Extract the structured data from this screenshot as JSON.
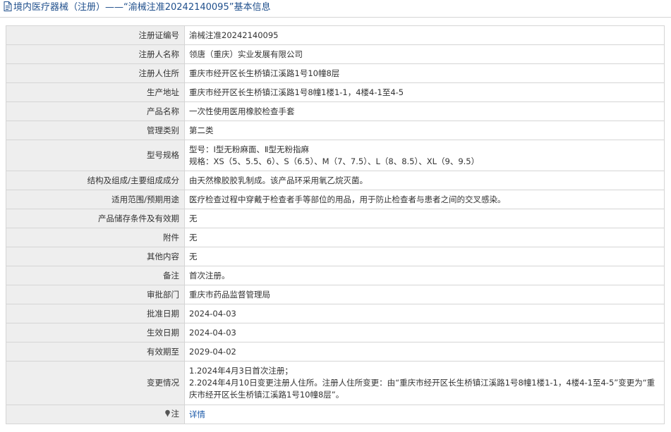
{
  "header": {
    "title": "境内医疗器械（注册）——“渝械注准20242140095”基本信息"
  },
  "fields": {
    "reg_no": {
      "label": "注册证编号",
      "value": "渝械注准20242140095"
    },
    "registrant": {
      "label": "注册人名称",
      "value": "领唐（重庆）实业发展有限公司"
    },
    "registrant_address": {
      "label": "注册人住所",
      "value": "重庆市经开区长生桥镇江溪路1号10幢8层"
    },
    "production_address": {
      "label": "生产地址",
      "value": "重庆市经开区长生桥镇江溪路1号8幢1楼1-1，4楼4-1至4-5"
    },
    "product_name": {
      "label": "产品名称",
      "value": "一次性使用医用橡胶检查手套"
    },
    "category": {
      "label": "管理类别",
      "value": "第二类"
    },
    "model": {
      "label": "型号规格",
      "line1": "型号：Ⅰ型无粉麻面、Ⅱ型无粉指麻",
      "line2": "规格：XS（5、5.5、6）、S（6.5）、M（7、7.5）、L（8、8.5）、XL（9、9.5）"
    },
    "composition": {
      "label": "结构及组成/主要组成成分",
      "value": "由天然橡胶胶乳制成。该产品环采用氧乙烷灭菌。"
    },
    "usage": {
      "label": "适用范围/预期用途",
      "value": "医疗检查过程中穿戴于检查者手等部位的用品，用于防止检查者与患者之间的交叉感染。"
    },
    "storage": {
      "label": "产品储存条件及有效期",
      "value": "无"
    },
    "attachment": {
      "label": "附件",
      "value": "无"
    },
    "other": {
      "label": "其他内容",
      "value": "无"
    },
    "remark": {
      "label": "备注",
      "value": "首次注册。"
    },
    "approval_dept": {
      "label": "审批部门",
      "value": "重庆市药品监督管理局"
    },
    "approval_date": {
      "label": "批准日期",
      "value": "2024-04-03"
    },
    "effective_date": {
      "label": "生效日期",
      "value": "2024-04-03"
    },
    "expiry_date": {
      "label": "有效期至",
      "value": "2029-04-02"
    },
    "changes": {
      "label": "变更情况",
      "line1": "1.2024年4月3日首次注册；",
      "line2": "2.2024年4月10日变更注册人住所。注册人住所变更：由“重庆市经开区长生桥镇江溪路1号8幢1楼1-1，4楼4-1至4-5”变更为“重",
      "line3": "庆市经开区长生桥镇江溪路1号10幢8层”。"
    },
    "note": {
      "label": "注",
      "link": "详情"
    }
  }
}
